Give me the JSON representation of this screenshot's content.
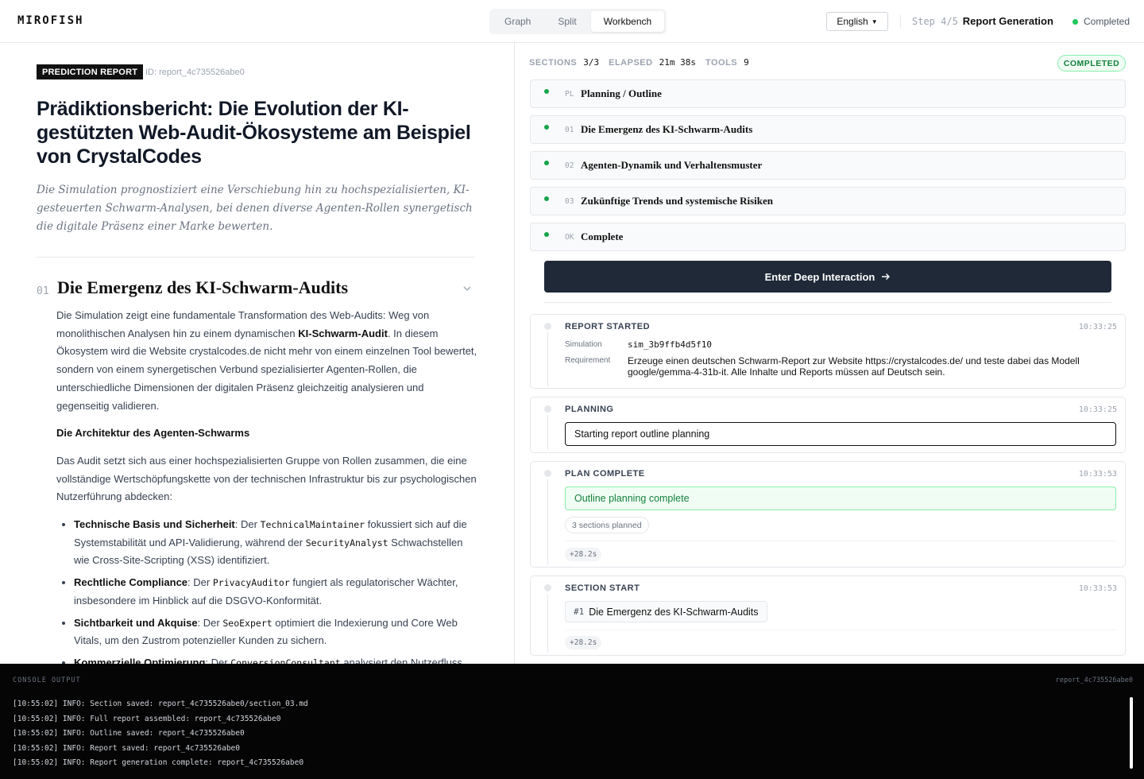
{
  "header": {
    "brand": "MIROFISH",
    "view_tabs": [
      {
        "label": "Graph"
      },
      {
        "label": "Split"
      },
      {
        "label": "Workbench",
        "active": true
      }
    ],
    "language": "English",
    "step_num": "Step 4/5",
    "step_name": "Report Generation",
    "status": "Completed",
    "status_color": "#22c55e"
  },
  "report": {
    "badge": "PREDICTION REPORT",
    "id_text": "ID: report_4c735526abe0",
    "title": "Prädiktionsbericht: Die Evolution der KI-gestützten Web-Audit-Ökosysteme am Beispiel von CrystalCodes",
    "subtitle": "Die Simulation prognostiziert eine Verschiebung hin zu hochspezialisierten, KI-gesteuerten Schwarm-Analysen, bei denen diverse Agenten-Rollen synergetisch die digitale Präsenz einer Marke bewerten.",
    "section": {
      "num": "01",
      "title": "Die Emergenz des KI-Schwarm-Audits",
      "p1_a": "Die Simulation zeigt eine fundamentale Transformation des Web-Audits: Weg von monolithischen Analysen hin zu einem dynamischen ",
      "p1_b": "KI-Schwarm-Audit",
      "p1_c": ". In diesem Ökosystem wird die Website crystalcodes.de nicht mehr von einem einzelnen Tool bewertet, sondern von einem synergetischen Verbund spezialisierter Agenten-Rollen, die unterschiedliche Dimensionen der digitalen Präsenz gleichzeitig analysieren und gegenseitig validieren.",
      "h4": "Die Architektur des Agenten-Schwarms",
      "p2": "Das Audit setzt sich aus einer hochspezialisierten Gruppe von Rollen zusammen, die eine vollständige Wertschöpfungskette von der technischen Infrastruktur bis zur psychologischen Nutzerführung abdecken:",
      "bullets": [
        {
          "bold": "Technische Basis und Sicherheit",
          "t1": ": Der ",
          "c1": "TechnicalMaintainer",
          "t2": " fokussiert sich auf die Systemstabilität und API-Validierung, während der ",
          "c2": "SecurityAnalyst",
          "t3": " Schwachstellen wie Cross-Site-Scripting (XSS) identifiziert."
        },
        {
          "bold": "Rechtliche Compliance",
          "t1": ": Der ",
          "c1": "PrivacyAuditor",
          "t2": " fungiert als regulatorischer Wächter, insbesondere im Hinblick auf die DSGVO-Konformität.",
          "c2": "",
          "t3": ""
        },
        {
          "bold": "Sichtbarkeit und Akquise",
          "t1": ": Der ",
          "c1": "SeoExpert",
          "t2": " optimiert die Indexierung und Core Web Vitals, um den Zustrom potenzieller Kunden zu sichern.",
          "c2": "",
          "t3": ""
        },
        {
          "bold": "Kommerzielle Optimierung",
          "t1": ": Der ",
          "c1": "ConversionConsultant",
          "t2": " analysiert den Nutzerfluss",
          "c2": "",
          "t3": ""
        }
      ]
    }
  },
  "workflow": {
    "meta": [
      {
        "k": "SECTIONS",
        "v": "3/3"
      },
      {
        "k": "ELAPSED",
        "v": "21m 38s"
      },
      {
        "k": "TOOLS",
        "v": "9"
      }
    ],
    "status_pill": "COMPLETED",
    "stages": [
      {
        "code": "PL",
        "name": "Planning / Outline"
      },
      {
        "code": "01",
        "name": "Die Emergenz des KI-Schwarm-Audits"
      },
      {
        "code": "02",
        "name": "Agenten-Dynamik und Verhaltensmuster"
      },
      {
        "code": "03",
        "name": "Zukünftige Trends und systemische Risiken"
      },
      {
        "code": "OK",
        "name": "Complete"
      }
    ],
    "cta": "Enter Deep Interaction",
    "events": {
      "started": {
        "title": "REPORT STARTED",
        "time": "10:33:25",
        "sim_label": "Simulation",
        "sim_value": "sim_3b9ffb4d5f10",
        "req_label": "Requirement",
        "req_value": "Erzeuge einen deutschen Schwarm-Report zur Website https://crystalcodes.de/ und teste dabei das Modell google/gemma-4-31b-it. Alle Inhalte und Reports müssen auf Deutsch sein."
      },
      "planning": {
        "title": "PLANNING",
        "time": "10:33:25",
        "msg": "Starting report outline planning"
      },
      "plan_complete": {
        "title": "PLAN COMPLETE",
        "time": "10:33:53",
        "msg": "Outline planning complete",
        "chip": "3 sections planned",
        "delta": "+28.2s"
      },
      "section_start": {
        "title": "SECTION START",
        "time": "10:33:53",
        "hash": "#1",
        "section": "Die Emergenz des KI-Schwarm-Audits",
        "delta": "+28.2s"
      }
    }
  },
  "console": {
    "label": "CONSOLE OUTPUT",
    "id": "report_4c735526abe0",
    "lines": [
      "[10:55:02] INFO: Section saved: report_4c735526abe0/section_03.md",
      "[10:55:02] INFO: Full report assembled: report_4c735526abe0",
      "[10:55:02] INFO: Outline saved: report_4c735526abe0",
      "[10:55:02] INFO: Report saved: report_4c735526abe0",
      "[10:55:02] INFO: Report generation complete: report_4c735526abe0"
    ]
  }
}
